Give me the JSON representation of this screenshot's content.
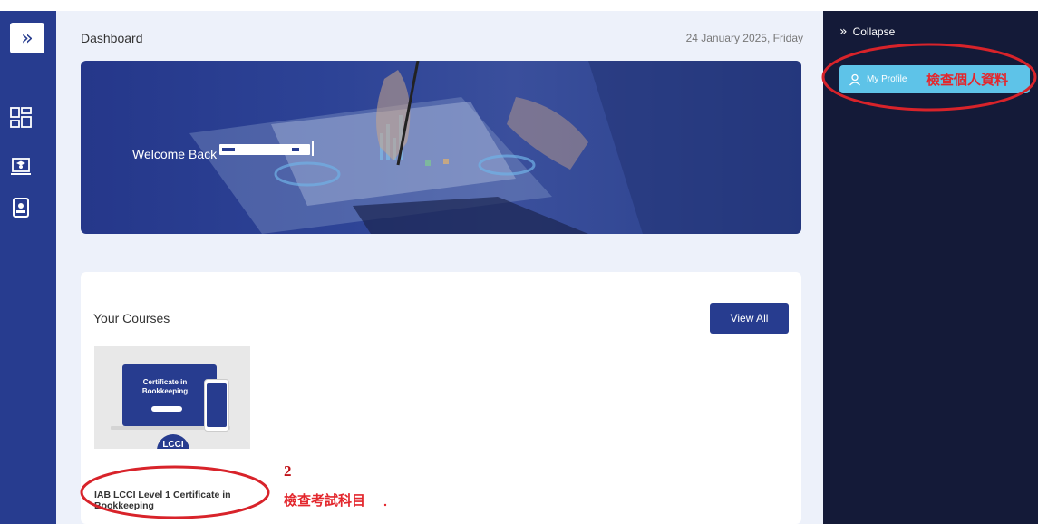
{
  "rail": {
    "toggle_icon": "double-chevron-right-icon",
    "items": [
      {
        "name": "dashboard",
        "icon": "dashboard-grid-icon",
        "active": true
      },
      {
        "name": "courses",
        "icon": "graduate-laptop-icon",
        "active": false
      },
      {
        "name": "profile-card",
        "icon": "id-badge-icon",
        "active": false
      }
    ]
  },
  "header": {
    "title": "Dashboard",
    "date": "24 January 2025, Friday"
  },
  "hero": {
    "welcome": "Welcome Back"
  },
  "courses": {
    "title": "Your Courses",
    "view_all": "View All",
    "items": [
      {
        "name": "IAB LCCI Level 1 Certificate in Bookkeeping",
        "thumb_title": "Certificate in Bookkeeping",
        "thumb_logo": "LCCI"
      }
    ]
  },
  "right_panel": {
    "collapse": "Collapse",
    "my_profile": "My Profile"
  },
  "annotations": {
    "profile_note": "檢查個人資料",
    "course_number": "2",
    "course_note": "檢查考試科目"
  },
  "colors": {
    "primary": "#273c8f",
    "panel_bg": "#141a38",
    "profile_accent": "#5ec3e8",
    "annotation_red": "#e3272d",
    "main_bg": "#edf1fa"
  }
}
